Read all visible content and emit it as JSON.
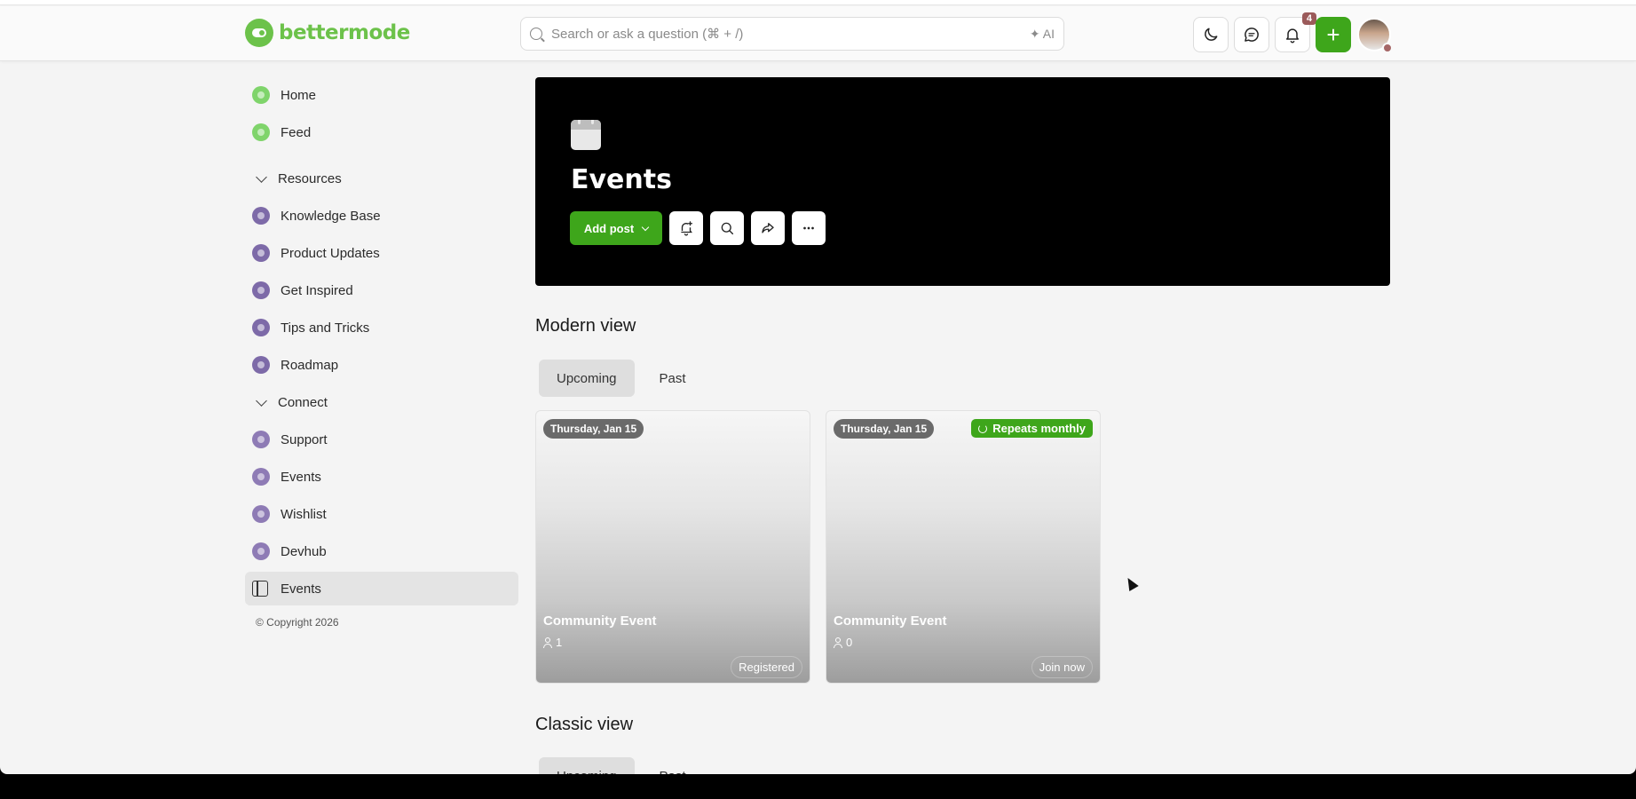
{
  "header": {
    "logo_text": "bettermode",
    "search_placeholder": "Search or ask a question (⌘ + /)",
    "ai_label": "✦ AI",
    "notification_count": "4",
    "plus_label": "+",
    "brand_color": "#6cc24a",
    "accent_color": "#3ea61b"
  },
  "sidebar": {
    "home": "Home",
    "feed": "Feed",
    "resources_label": "Resources",
    "resources": [
      "Knowledge Base",
      "Product Updates",
      "Get Inspired",
      "Tips and Tricks",
      "Roadmap"
    ],
    "connect_label": "Connect",
    "connect": [
      "Support",
      "Events",
      "Wishlist",
      "Devhub"
    ],
    "active_item": "Events",
    "copyright": "© Copyright 2026"
  },
  "banner": {
    "title": "Events",
    "add_post_label": "Add post"
  },
  "modern_view": {
    "heading": "Modern view",
    "tabs": [
      "Upcoming",
      "Past"
    ],
    "cards": [
      {
        "date": "Thursday, Jan 15",
        "title": "Community Event",
        "attendees": "1",
        "action": "Registered"
      },
      {
        "date": "Thursday, Jan 15",
        "repeat": "Repeats monthly",
        "title": "Community Event",
        "attendees": "0",
        "action": "Join now"
      }
    ]
  },
  "classic_view": {
    "heading": "Classic view",
    "tabs": [
      "Upcoming",
      "Past"
    ]
  }
}
